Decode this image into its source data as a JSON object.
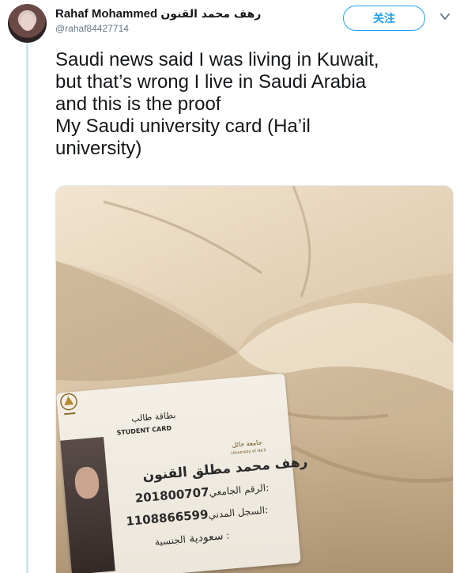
{
  "tweet": {
    "display_name": "Rahaf Mohammed",
    "display_name_arabic": "رهف محمد القنون",
    "handle": "@rahaf84427714",
    "follow_label": "关注",
    "text_lines": [
      "Saudi news said I was living in Kuwait,",
      "but that’s wrong I live in Saudi Arabia",
      "and this is the proof",
      "My Saudi university card (Ha’il",
      "university)"
    ]
  },
  "card": {
    "title_arabic": "بطاقة طالب",
    "title_english": "STUDENT CARD",
    "university_arabic": "جامعة حائل",
    "university_english": "University of Ha'il",
    "name_arabic": "رهف محمد مطلق القنون",
    "university_number_label": "الرقم الجامعي:",
    "university_number": "201800707",
    "civil_record_label": "السجل المدني:",
    "civil_record_number": "1108866599",
    "nationality_label": "الجنسية :",
    "nationality": "سعودية"
  },
  "icons": {
    "caret": "chevron-down-icon",
    "avatar": "profile-avatar"
  },
  "colors": {
    "accent": "#1da1f2",
    "text": "#14171a",
    "secondary": "#657786",
    "thread_line": "#cfe5ef"
  }
}
